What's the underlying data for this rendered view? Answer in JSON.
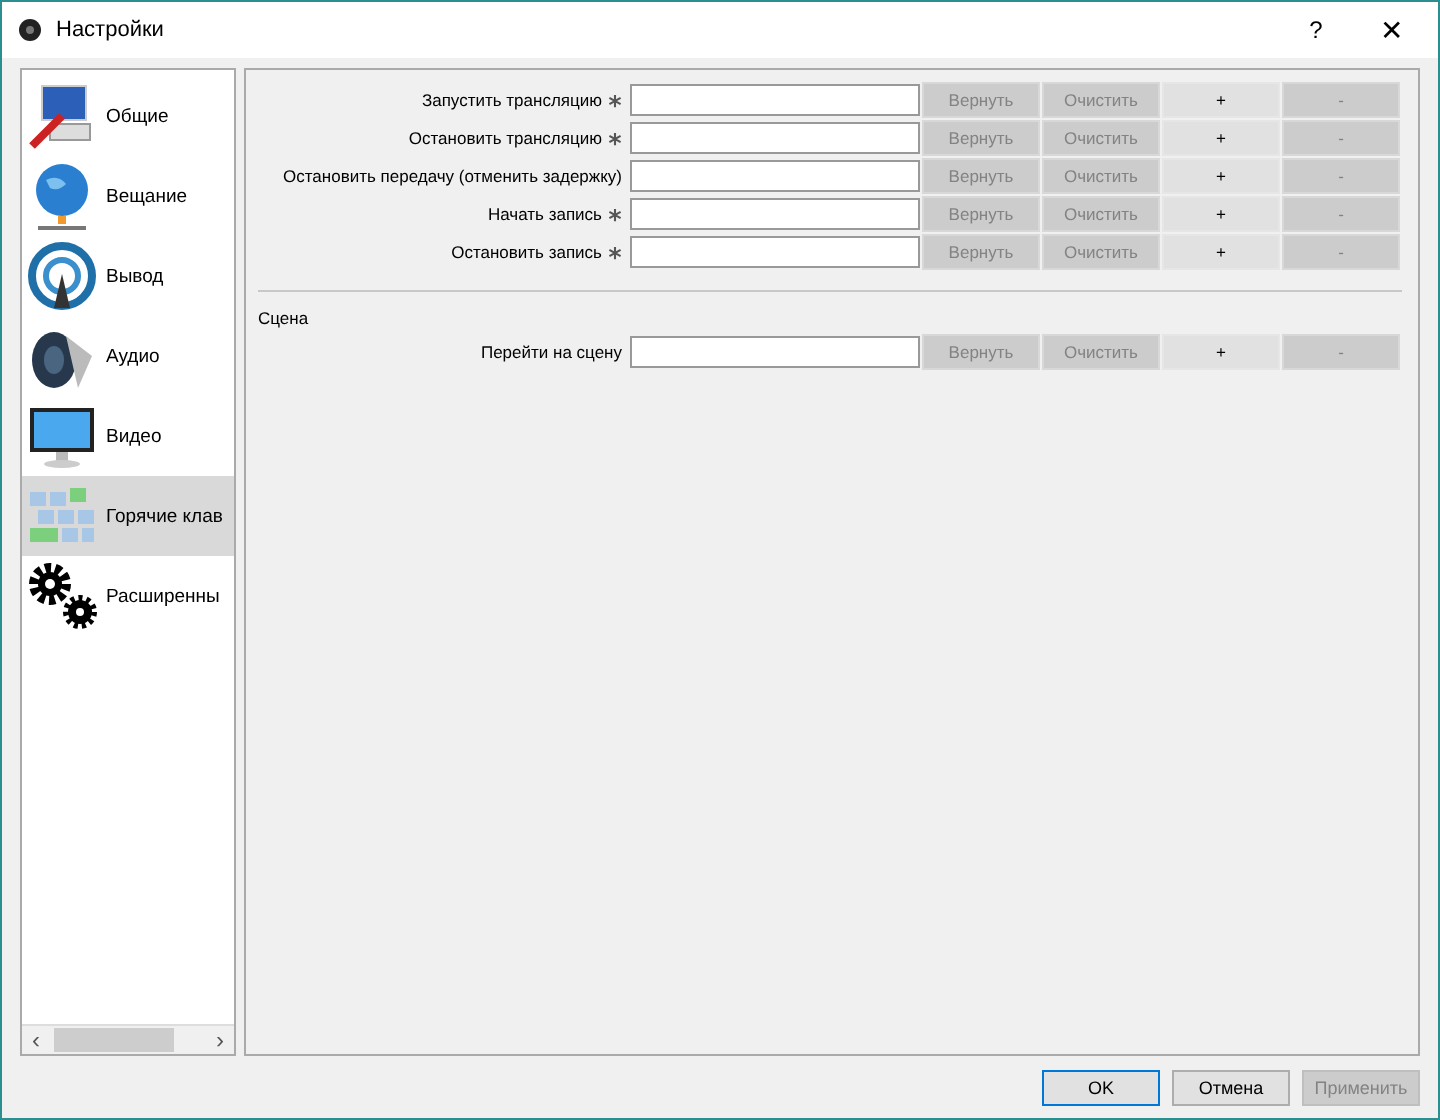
{
  "window": {
    "title": "Настройки",
    "help": "?",
    "close": "✕"
  },
  "sidebar": {
    "items": [
      {
        "label": "Общие",
        "kind": "computer",
        "selected": false
      },
      {
        "label": "Вещание",
        "kind": "globe",
        "selected": false
      },
      {
        "label": "Вывод",
        "kind": "antenna",
        "selected": false
      },
      {
        "label": "Аудио",
        "kind": "speaker",
        "selected": false
      },
      {
        "label": "Видео",
        "kind": "monitor",
        "selected": false
      },
      {
        "label": "Горячие клав",
        "kind": "keys",
        "selected": true
      },
      {
        "label": "Расширенны",
        "kind": "gears",
        "selected": false
      }
    ],
    "scroll_left": "‹",
    "scroll_right": "›"
  },
  "sections": [
    {
      "rows": [
        {
          "label": "Запустить трансляцию",
          "marked": true,
          "buttons": [
            {
              "label": "Вернуть",
              "disabled": true
            },
            {
              "label": "Очистить",
              "disabled": true
            },
            {
              "label": "+",
              "disabled": false
            },
            {
              "label": "-",
              "disabled": true
            }
          ]
        },
        {
          "label": "Остановить трансляцию",
          "marked": true,
          "buttons": [
            {
              "label": "Вернуть",
              "disabled": true
            },
            {
              "label": "Очистить",
              "disabled": true
            },
            {
              "label": "+",
              "disabled": false
            },
            {
              "label": "-",
              "disabled": true
            }
          ]
        },
        {
          "label": "Остановить передачу (отменить задержку)",
          "marked": false,
          "buttons": [
            {
              "label": "Вернуть",
              "disabled": true
            },
            {
              "label": "Очистить",
              "disabled": true
            },
            {
              "label": "+",
              "disabled": false
            },
            {
              "label": "-",
              "disabled": true
            }
          ]
        },
        {
          "label": "Начать запись",
          "marked": true,
          "buttons": [
            {
              "label": "Вернуть",
              "disabled": true
            },
            {
              "label": "Очистить",
              "disabled": true
            },
            {
              "label": "+",
              "disabled": false
            },
            {
              "label": "-",
              "disabled": true
            }
          ]
        },
        {
          "label": "Остановить запись",
          "marked": true,
          "buttons": [
            {
              "label": "Вернуть",
              "disabled": true
            },
            {
              "label": "Очистить",
              "disabled": true
            },
            {
              "label": "+",
              "disabled": false
            },
            {
              "label": "-",
              "disabled": true
            }
          ]
        }
      ]
    },
    {
      "title": "Сцена",
      "rows": [
        {
          "label": "Перейти на сцену",
          "marked": false,
          "buttons": [
            {
              "label": "Вернуть",
              "disabled": true
            },
            {
              "label": "Очистить",
              "disabled": true
            },
            {
              "label": "+",
              "disabled": false
            },
            {
              "label": "-",
              "disabled": true
            }
          ]
        }
      ]
    }
  ],
  "footer": {
    "buttons": [
      {
        "label": "OK",
        "disabled": false,
        "default": true
      },
      {
        "label": "Отмена",
        "disabled": false,
        "default": false
      },
      {
        "label": "Применить",
        "disabled": true,
        "default": false
      }
    ]
  }
}
